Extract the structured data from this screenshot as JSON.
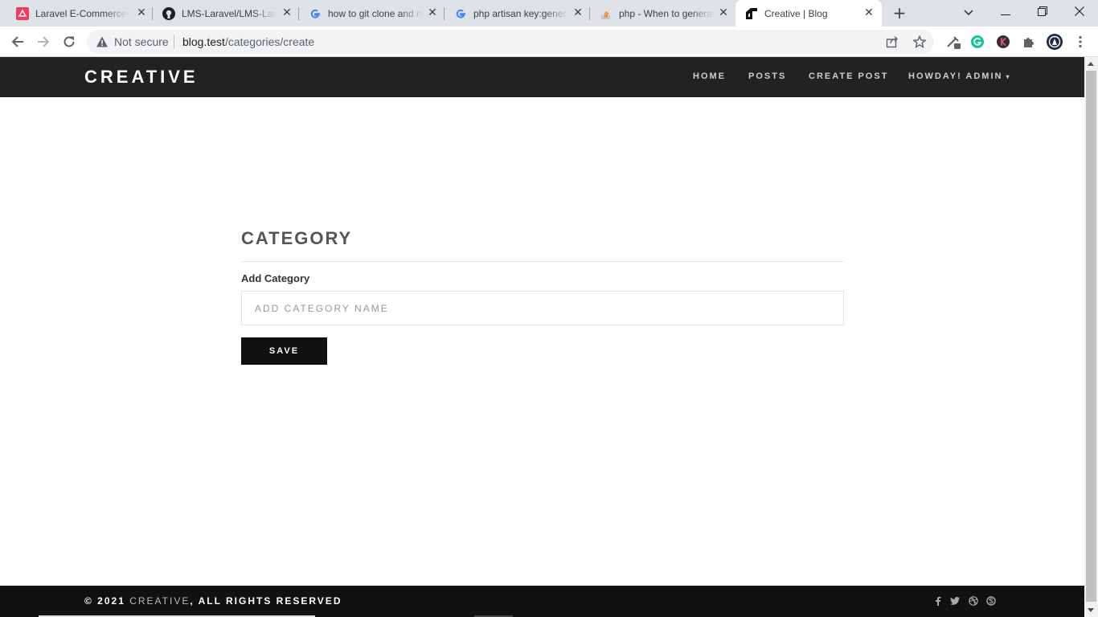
{
  "browser": {
    "tabs": [
      {
        "title": "Laravel E-Commerce Admin",
        "icon": "laravel-icon"
      },
      {
        "title": "LMS-Laravel/LMS-Laravel",
        "icon": "github-icon"
      },
      {
        "title": "how to git clone and run",
        "icon": "google-icon"
      },
      {
        "title": "php artisan key:generate",
        "icon": "google-icon"
      },
      {
        "title": "php - When to generate",
        "icon": "stackoverflow-icon"
      },
      {
        "title": "Creative | Blog",
        "icon": "creative-icon",
        "active": true
      }
    ],
    "security_label": "Not secure",
    "url_host": "blog.test",
    "url_path": "/categories/create"
  },
  "site": {
    "brand": "CREATIVE",
    "nav": {
      "home": "HOME",
      "posts": "POSTS",
      "create_post": "CREATE POST",
      "user_menu": "HOWDAY! ADMIN"
    }
  },
  "form": {
    "heading": "CATEGORY",
    "label": "Add Category",
    "input_value": "",
    "placeholder": "ADD CATEGORY NAME",
    "save_label": "SAVE"
  },
  "footer": {
    "prefix": "© 2021 ",
    "brand": "CREATIVE",
    "suffix": ", ALL RIGHTS RESERVED",
    "social_icons": [
      "facebook-icon",
      "twitter-icon",
      "dribbble-icon",
      "skype-icon"
    ]
  },
  "colors": {
    "header_bg": "#222222",
    "footer_bg": "#111111",
    "button_bg": "#111111",
    "heading_text": "#555555"
  }
}
